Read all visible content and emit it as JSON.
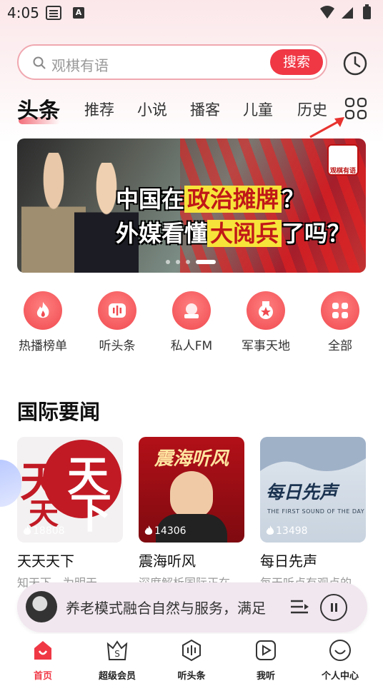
{
  "status": {
    "time": "4:05",
    "notif_a": "A"
  },
  "search": {
    "placeholder": "观棋有语",
    "button": "搜索"
  },
  "tabs": [
    {
      "label": "头条",
      "active": true
    },
    {
      "label": "推荐"
    },
    {
      "label": "小说"
    },
    {
      "label": "播客"
    },
    {
      "label": "儿童"
    },
    {
      "label": "历史"
    }
  ],
  "banner": {
    "line1_pre": "中国在",
    "line1_hl": "政治摊牌",
    "line1_post": "？",
    "line2_pre": "外媒看懂",
    "line2_hl": "大阅兵",
    "line2_post": "了吗？",
    "logo_text": "观棋有语",
    "slide_count": 4,
    "active_slide": 4
  },
  "quick_links": [
    {
      "label": "热播榜单",
      "icon": "flame-icon"
    },
    {
      "label": "听头条",
      "icon": "sound-wave-icon"
    },
    {
      "label": "私人FM",
      "icon": "radio-icon"
    },
    {
      "label": "军事天地",
      "icon": "medal-icon"
    },
    {
      "label": "全部",
      "icon": "grid-icon"
    }
  ],
  "section": {
    "title": "国际要闻"
  },
  "cards": [
    {
      "title": "天天天下",
      "subtitle": "知天下，为明天",
      "count": "18808",
      "cover_chars": [
        "天",
        "天",
        "天",
        "下"
      ]
    },
    {
      "title": "震海听风",
      "subtitle": "深度解析国际正在",
      "count": "14306",
      "cover_title": "震海听风"
    },
    {
      "title": "每日先声",
      "subtitle": "每天听点有观点的",
      "count": "13498",
      "cover_title": "每日先声",
      "cover_sub": "THE FIRST SOUND OF THE DAY"
    }
  ],
  "player": {
    "title": "养老模式融合自然与服务，满足"
  },
  "nav": [
    {
      "label": "首页",
      "active": true
    },
    {
      "label": "超级会员"
    },
    {
      "label": "听头条"
    },
    {
      "label": "我听"
    },
    {
      "label": "个人中心"
    }
  ],
  "colors": {
    "accent": "#f03845",
    "brand_red": "#c11a25"
  }
}
